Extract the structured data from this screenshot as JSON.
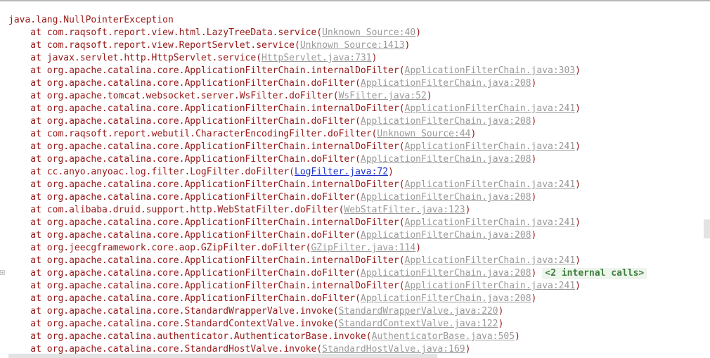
{
  "exception": {
    "title": "java.lang.NullPointerException",
    "frames": [
      {
        "prefix": "    at com.raqsoft.report.view.html.LazyTreeData.service(",
        "link": "Unknown Source:40",
        "suffix": ")"
      },
      {
        "prefix": "    at com.raqsoft.report.view.ReportServlet.service(",
        "link": "Unknown Source:1413",
        "suffix": ")"
      },
      {
        "prefix": "    at javax.servlet.http.HttpServlet.service(",
        "link": "HttpServlet.java:731",
        "suffix": ")"
      },
      {
        "prefix": "    at org.apache.catalina.core.ApplicationFilterChain.internalDoFilter(",
        "link": "ApplicationFilterChain.java:303",
        "suffix": ")"
      },
      {
        "prefix": "    at org.apache.catalina.core.ApplicationFilterChain.doFilter(",
        "link": "ApplicationFilterChain.java:208",
        "suffix": ")"
      },
      {
        "prefix": "    at org.apache.tomcat.websocket.server.WsFilter.doFilter(",
        "link": "WsFilter.java:52",
        "suffix": ")"
      },
      {
        "prefix": "    at org.apache.catalina.core.ApplicationFilterChain.internalDoFilter(",
        "link": "ApplicationFilterChain.java:241",
        "suffix": ")"
      },
      {
        "prefix": "    at org.apache.catalina.core.ApplicationFilterChain.doFilter(",
        "link": "ApplicationFilterChain.java:208",
        "suffix": ")"
      },
      {
        "prefix": "    at com.raqsoft.report.webutil.CharacterEncodingFilter.doFilter(",
        "link": "Unknown Source:44",
        "suffix": ")"
      },
      {
        "prefix": "    at org.apache.catalina.core.ApplicationFilterChain.internalDoFilter(",
        "link": "ApplicationFilterChain.java:241",
        "suffix": ")"
      },
      {
        "prefix": "    at org.apache.catalina.core.ApplicationFilterChain.doFilter(",
        "link": "ApplicationFilterChain.java:208",
        "suffix": ")"
      },
      {
        "prefix": "    at cc.anyo.anyoac.log.filter.LogFilter.doFilter(",
        "link": "LogFilter.java:72",
        "suffix": ")",
        "active": true
      },
      {
        "prefix": "    at org.apache.catalina.core.ApplicationFilterChain.internalDoFilter(",
        "link": "ApplicationFilterChain.java:241",
        "suffix": ")"
      },
      {
        "prefix": "    at org.apache.catalina.core.ApplicationFilterChain.doFilter(",
        "link": "ApplicationFilterChain.java:208",
        "suffix": ")"
      },
      {
        "prefix": "    at com.alibaba.druid.support.http.WebStatFilter.doFilter(",
        "link": "WebStatFilter.java:123",
        "suffix": ")"
      },
      {
        "prefix": "    at org.apache.catalina.core.ApplicationFilterChain.internalDoFilter(",
        "link": "ApplicationFilterChain.java:241",
        "suffix": ")"
      },
      {
        "prefix": "    at org.apache.catalina.core.ApplicationFilterChain.doFilter(",
        "link": "ApplicationFilterChain.java:208",
        "suffix": ")"
      },
      {
        "prefix": "    at org.jeecgframework.core.aop.GZipFilter.doFilter(",
        "link": "GZipFilter.java:114",
        "suffix": ")"
      },
      {
        "prefix": "    at org.apache.catalina.core.ApplicationFilterChain.internalDoFilter(",
        "link": "ApplicationFilterChain.java:241",
        "suffix": ")"
      },
      {
        "prefix": "    at org.apache.catalina.core.ApplicationFilterChain.doFilter(",
        "link": "ApplicationFilterChain.java:208",
        "suffix": ")",
        "badge": "<2 internal calls>"
      },
      {
        "prefix": "    at org.apache.catalina.core.ApplicationFilterChain.internalDoFilter(",
        "link": "ApplicationFilterChain.java:241",
        "suffix": ")"
      },
      {
        "prefix": "    at org.apache.catalina.core.ApplicationFilterChain.doFilter(",
        "link": "ApplicationFilterChain.java:208",
        "suffix": ")"
      },
      {
        "prefix": "    at org.apache.catalina.core.StandardWrapperValve.invoke(",
        "link": "StandardWrapperValve.java:220",
        "suffix": ")"
      },
      {
        "prefix": "    at org.apache.catalina.core.StandardContextValve.invoke(",
        "link": "StandardContextValve.java:122",
        "suffix": ")"
      },
      {
        "prefix": "    at org.apache.catalina.authenticator.AuthenticatorBase.invoke(",
        "link": "AuthenticatorBase.java:505",
        "suffix": ")"
      },
      {
        "prefix": "    at org.apache.catalina.core.StandardHostValve.invoke(",
        "link": "StandardHostValve.java:169",
        "suffix": ")"
      }
    ]
  },
  "colors": {
    "error_text": "#961717",
    "link_gray": "#9a9a9a",
    "link_active": "#1f33c9",
    "badge_bg": "#eef5ec",
    "badge_text": "#3f7f3f"
  },
  "icons": {
    "fold": "expand-plus-icon"
  }
}
